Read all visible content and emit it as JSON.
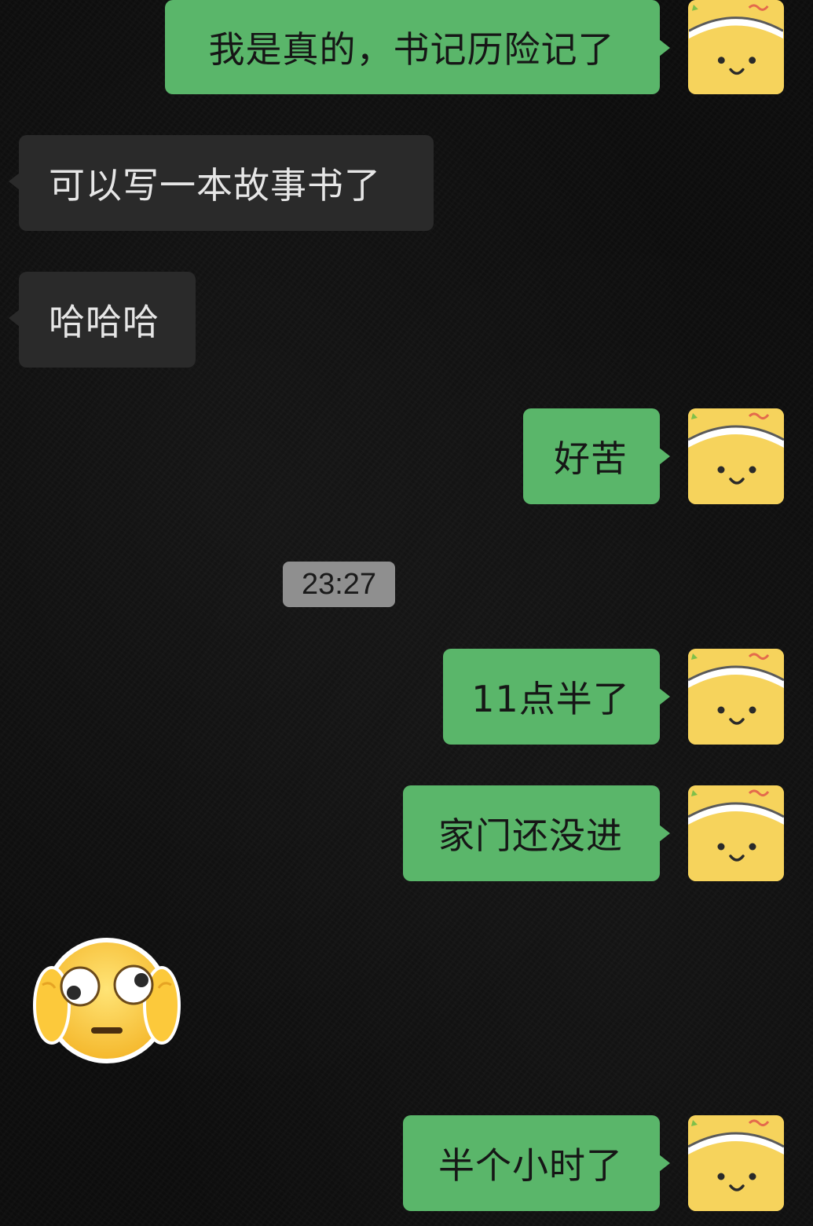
{
  "messages": [
    {
      "direction": "out",
      "text": "我是真的，书记历险记了"
    },
    {
      "direction": "in",
      "text": "可以写一本故事书了"
    },
    {
      "direction": "in",
      "text": "哈哈哈"
    },
    {
      "direction": "out",
      "text": "好苦"
    },
    {
      "direction": "out",
      "text": "11点半了"
    },
    {
      "direction": "out",
      "text": "家门还没进"
    },
    {
      "direction": "in",
      "type": "sticker",
      "icon": "flushed-emoji-covering-ears"
    },
    {
      "direction": "out",
      "text": "半个小时了"
    }
  ],
  "timestamp": "23:27",
  "colors": {
    "outgoing_bubble": "#5ab66a",
    "incoming_bubble": "#2a2a2a",
    "avatar_background": "#f6d35c",
    "timestamp_background": "#8f8f8f",
    "chat_background": "#0d0d0d"
  },
  "avatar_icon": "smiling-yellow-face-avatar"
}
